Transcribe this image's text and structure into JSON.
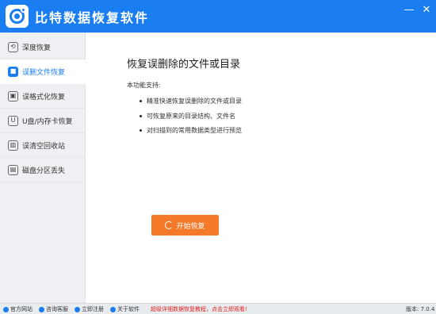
{
  "window": {
    "title": "比特数据恢复软件",
    "minimize_glyph": "—",
    "close_glyph": "✕"
  },
  "sidebar": {
    "items": [
      {
        "label": "深度恢复",
        "icon": "refresh-icon",
        "glyph": "⟲"
      },
      {
        "label": "误删文件恢复",
        "icon": "folder-icon",
        "glyph": "■",
        "active": true
      },
      {
        "label": "误格式化恢复",
        "icon": "format-icon",
        "glyph": "▣"
      },
      {
        "label": "U盘/内存卡恢复",
        "icon": "usb-icon",
        "glyph": "U"
      },
      {
        "label": "误清空回收站",
        "icon": "trash-icon",
        "glyph": "▥"
      },
      {
        "label": "磁盘分区丢失",
        "icon": "disk-icon",
        "glyph": "▤"
      }
    ]
  },
  "main": {
    "heading": "恢复误删除的文件或目录",
    "subheading": "本功能支持:",
    "features": [
      "精准快速恢复误删除的文件或目录",
      "可恢复原来的目录结构、文件名",
      "对扫描到的常用数据类型进行预览"
    ],
    "start_button": "开始恢复"
  },
  "footer": {
    "links": [
      "官方网站",
      "咨询客服",
      "立即注册",
      "关于软件"
    ],
    "promo": "超级详细数据恢复教程，点击立即观看!",
    "version": "版本: 7.0.4"
  },
  "colors": {
    "primary": "#1a7ef2",
    "accent": "#f47a2a",
    "promo": "#e02020"
  }
}
